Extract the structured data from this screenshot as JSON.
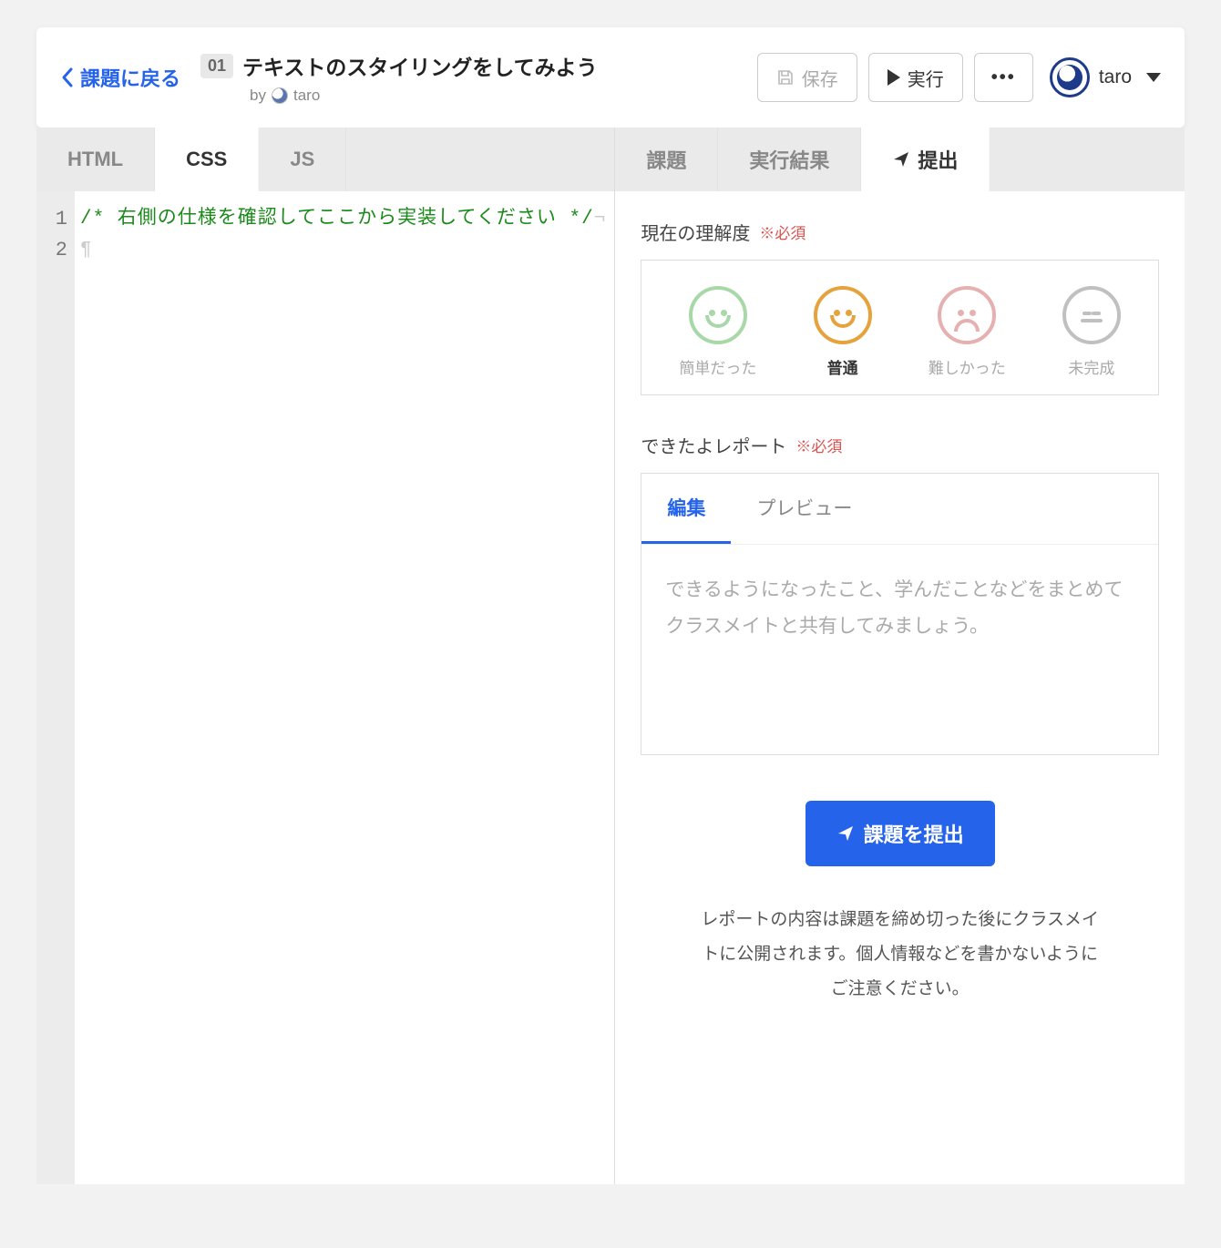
{
  "header": {
    "back_label": "課題に戻る",
    "lesson_number": "01",
    "title": "テキストのスタイリングをしてみよう",
    "by_prefix": "by",
    "author": "taro",
    "save_label": "保存",
    "run_label": "実行",
    "user_name": "taro"
  },
  "editor_tabs": {
    "html": "HTML",
    "css": "CSS",
    "js": "JS",
    "active": "css"
  },
  "editor": {
    "lines": [
      "1",
      "2"
    ],
    "code_line1": "/* 右側の仕様を確認してここから実装してください */"
  },
  "right_tabs": {
    "task": "課題",
    "result": "実行結果",
    "submit": "提出",
    "active": "submit"
  },
  "rating": {
    "section_label": "現在の理解度",
    "required": "※必須",
    "items": [
      {
        "label": "簡単だった",
        "color": "green",
        "selected": false
      },
      {
        "label": "普通",
        "color": "orange",
        "selected": true
      },
      {
        "label": "難しかった",
        "color": "red",
        "selected": false
      },
      {
        "label": "未完成",
        "color": "gray",
        "selected": false
      }
    ]
  },
  "report": {
    "section_label": "できたよレポート",
    "required": "※必須",
    "tab_edit": "編集",
    "tab_preview": "プレビュー",
    "placeholder": "できるようになったこと、学んだことなどをまとめてクラスメイトと共有してみましょう。"
  },
  "submit": {
    "button_label": "課題を提出",
    "notice": "レポートの内容は課題を締め切った後にクラスメイトに公開されます。個人情報などを書かないようにご注意ください。"
  }
}
